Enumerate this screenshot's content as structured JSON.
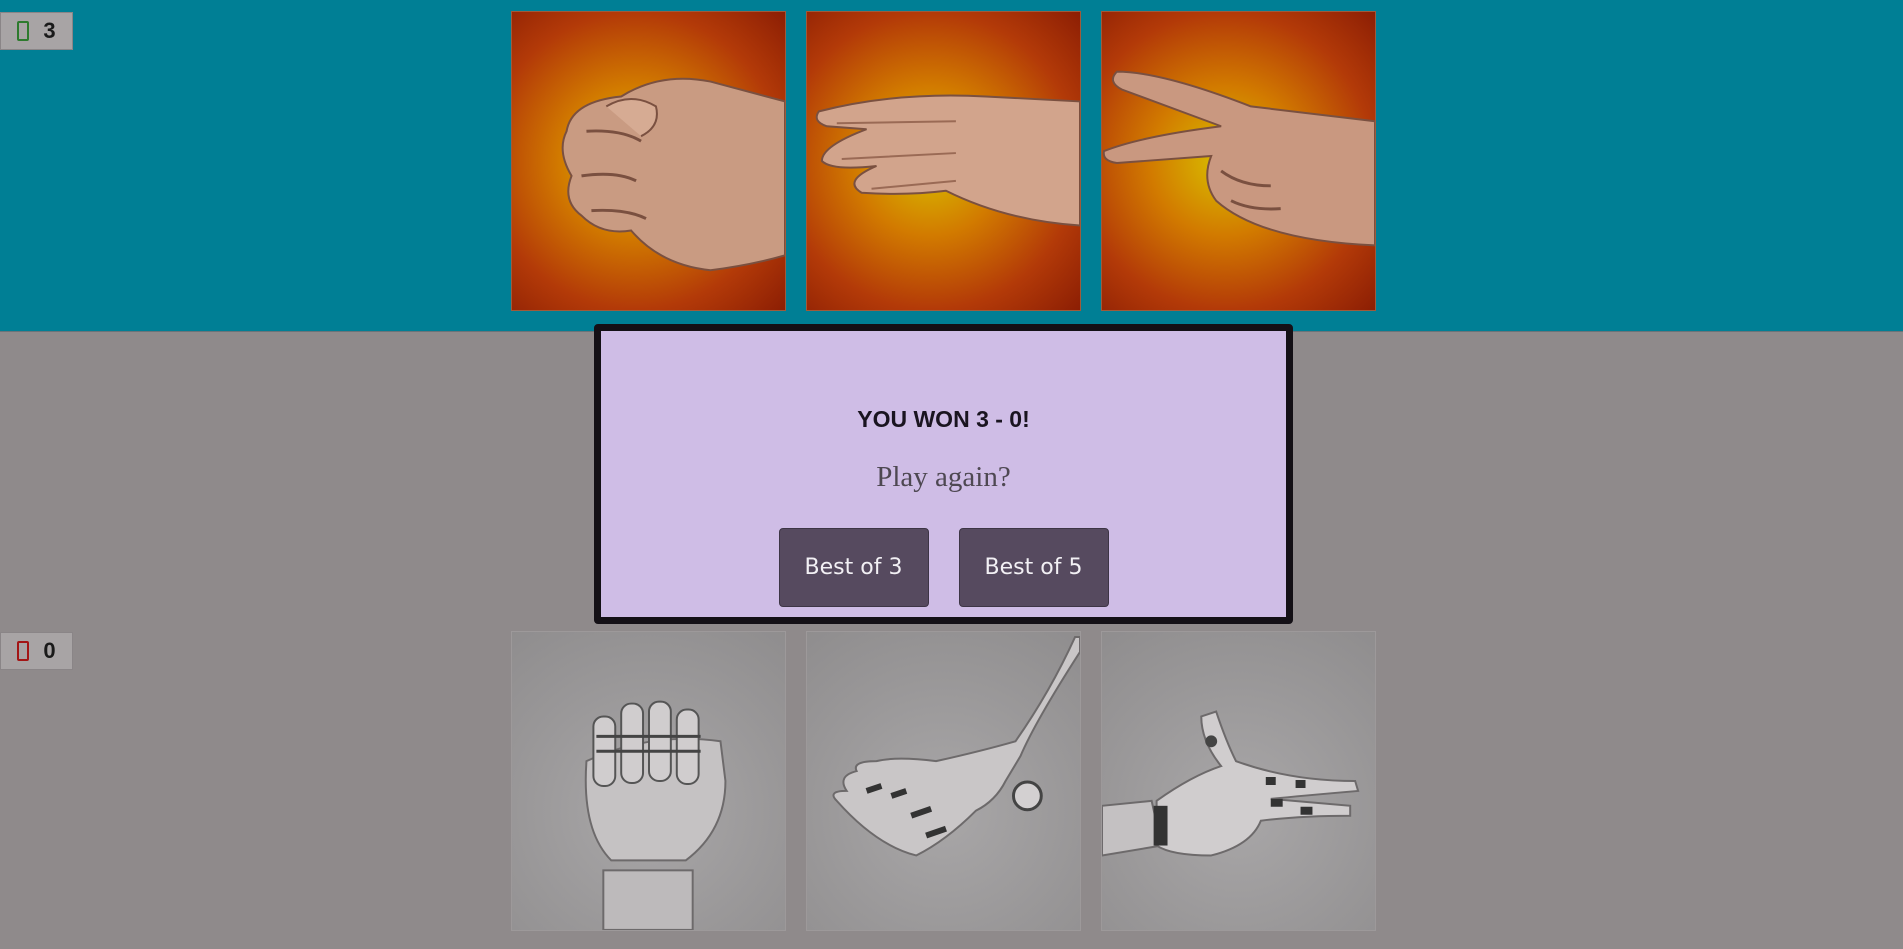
{
  "scores": {
    "player": {
      "icon": "user-icon",
      "value": "3",
      "color": "#2d7a2d"
    },
    "cpu": {
      "icon": "cpu-icon",
      "value": "0",
      "color": "#a31515"
    }
  },
  "player_choices": [
    {
      "name": "rock",
      "icon": "fist-icon"
    },
    {
      "name": "paper",
      "icon": "flat-hand-icon"
    },
    {
      "name": "scissors",
      "icon": "two-fingers-icon"
    }
  ],
  "cpu_choices": [
    {
      "name": "rock",
      "icon": "robot-fist-icon"
    },
    {
      "name": "paper",
      "icon": "robot-flat-hand-icon"
    },
    {
      "name": "scissors",
      "icon": "robot-two-fingers-icon"
    }
  ],
  "modal": {
    "title": "YOU WON 3 - 0!",
    "subtitle": "Play again?",
    "buttons": [
      "Best of 3",
      "Best of 5"
    ]
  },
  "colors": {
    "top_background": "#007f95",
    "modal_background": "#cfbde6",
    "button_background": "#564a5f"
  }
}
